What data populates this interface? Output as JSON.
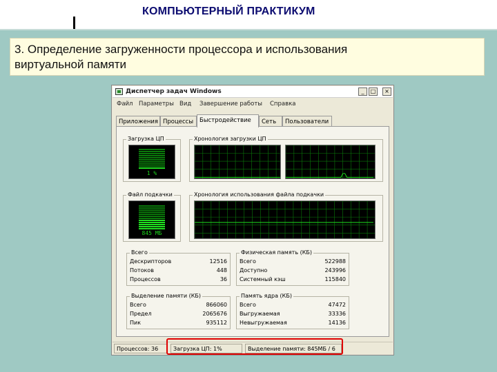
{
  "slide": {
    "header_title": "КОМПЬЮТЕРНЫЙ ПРАКТИКУМ",
    "heading_line1": "3. Определение загруженности процессора и использования",
    "heading_line2": "виртуальной памяти"
  },
  "window": {
    "title": "Диспетчер задач Windows",
    "controls": [
      "_",
      "□",
      "×"
    ],
    "icon": "task-manager-icon",
    "menu": [
      "Файл",
      "Параметры",
      "Вид",
      "Завершение работы",
      "Справка"
    ],
    "tabs": [
      "Приложения",
      "Процессы",
      "Быстродействие",
      "Сеть",
      "Пользователи"
    ],
    "active_tab": "Быстродействие"
  },
  "performance": {
    "cpu_usage_caption": "Загрузка ЦП",
    "cpu_usage_value": "1 %",
    "cpu_usage_percent": 1,
    "cpu_history_caption": "Хронология загрузки ЦП",
    "pagefile_caption": "Файл подкачки",
    "pagefile_value": "845 МБ",
    "pagefile_fraction": 0.41,
    "pagefile_history_caption": "Хронология использования файла подкачки",
    "colors": {
      "graph_bg": "#000000",
      "grid": "#0a7a0a",
      "line": "#1fe01f"
    }
  },
  "totals": {
    "caption": "Всего",
    "rows": [
      {
        "label": "Дескрипторов",
        "value": "12516"
      },
      {
        "label": "Потоков",
        "value": "448"
      },
      {
        "label": "Процессов",
        "value": "36"
      }
    ]
  },
  "physical_memory": {
    "caption": "Физическая память (КБ)",
    "rows": [
      {
        "label": "Всего",
        "value": "522988"
      },
      {
        "label": "Доступно",
        "value": "243996"
      },
      {
        "label": "Системный кэш",
        "value": "115840"
      }
    ]
  },
  "commit_charge": {
    "caption": "Выделение памяти (КБ)",
    "rows": [
      {
        "label": "Всего",
        "value": "866060"
      },
      {
        "label": "Предел",
        "value": "2065676"
      },
      {
        "label": "Пик",
        "value": "935112"
      }
    ]
  },
  "kernel_memory": {
    "caption": "Память ядра (КБ)",
    "rows": [
      {
        "label": "Всего",
        "value": "47472"
      },
      {
        "label": "Выгружаемая",
        "value": "33336"
      },
      {
        "label": "Невыгружаемая",
        "value": "14136"
      }
    ]
  },
  "statusbar": {
    "processes": "Процессов: 36",
    "cpu": "Загрузка ЦП: 1%",
    "commit": "Выделение памяти: 845МБ / 6"
  }
}
